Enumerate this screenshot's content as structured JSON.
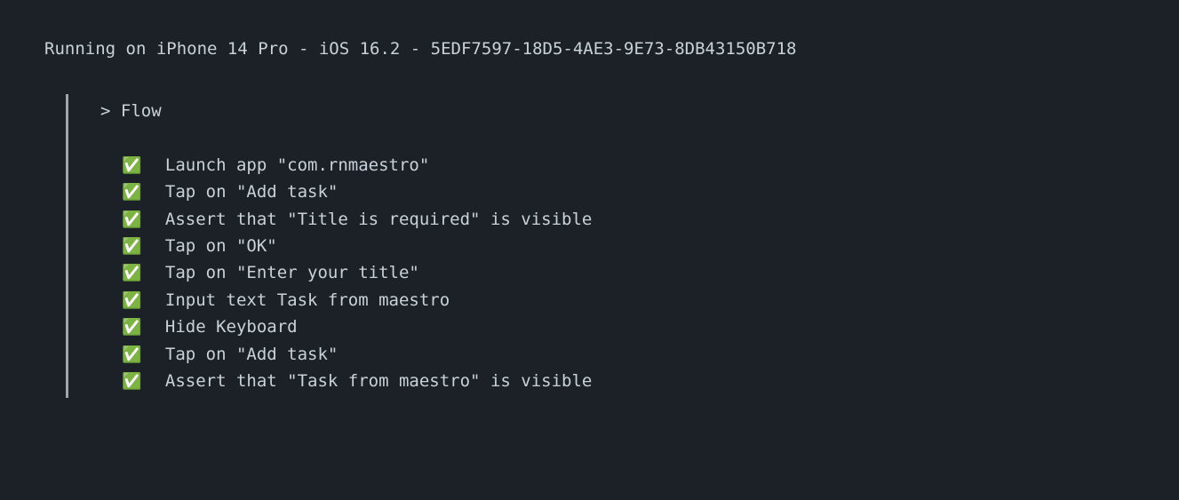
{
  "header": "Running on iPhone 14 Pro - iOS 16.2 - 5EDF7597-18D5-4AE3-9E73-8DB43150B718",
  "flow": {
    "prompt": "> Flow",
    "check_icon": "✅",
    "steps": [
      "Launch app \"com.rnmaestro\"",
      "Tap on \"Add task\"",
      "Assert that \"Title is required\" is visible",
      "Tap on \"OK\"",
      "Tap on \"Enter your title\"",
      "Input text Task from maestro",
      "Hide Keyboard",
      "Tap on \"Add task\"",
      "Assert that \"Task from maestro\" is visible"
    ]
  }
}
